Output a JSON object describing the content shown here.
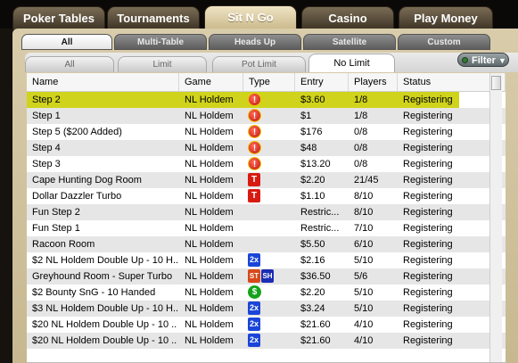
{
  "main_tabs": [
    "Poker Tables",
    "Tournaments",
    "Sit N Go",
    "Casino",
    "Play Money"
  ],
  "active_main_tab": "Sit N Go",
  "sub_tabs": [
    "All",
    "Multi-Table",
    "Heads Up",
    "Satellite",
    "Custom"
  ],
  "active_sub_tab": "All",
  "limit_tabs": [
    "All",
    "Limit",
    "Pot Limit",
    "No Limit"
  ],
  "active_limit_tab": "No Limit",
  "filter_label": "Filter",
  "columns": [
    "Name",
    "Game",
    "Type",
    "Entry",
    "Players",
    "Status"
  ],
  "rows": [
    {
      "name": "Step 2",
      "game": "NL Holdem",
      "type": "excl",
      "entry": "$3.60",
      "players": "1/8",
      "status": "Registering"
    },
    {
      "name": "Step 1",
      "game": "NL Holdem",
      "type": "excl",
      "entry": "$1",
      "players": "1/8",
      "status": "Registering"
    },
    {
      "name": "Step 5 ($200 Added)",
      "game": "NL Holdem",
      "type": "excl",
      "entry": "$176",
      "players": "0/8",
      "status": "Registering"
    },
    {
      "name": "Step 4",
      "game": "NL Holdem",
      "type": "excl",
      "entry": "$48",
      "players": "0/8",
      "status": "Registering"
    },
    {
      "name": "Step 3",
      "game": "NL Holdem",
      "type": "excl",
      "entry": "$13.20",
      "players": "0/8",
      "status": "Registering"
    },
    {
      "name": "Cape Hunting Dog Room",
      "game": "NL Holdem",
      "type": "t",
      "entry": "$2.20",
      "players": "21/45",
      "status": "Registering"
    },
    {
      "name": "Dollar Dazzler Turbo",
      "game": "NL Holdem",
      "type": "t",
      "entry": "$1.10",
      "players": "8/10",
      "status": "Registering"
    },
    {
      "name": "Fun Step 2",
      "game": "NL Holdem",
      "type": "",
      "entry": "Restric...",
      "players": "8/10",
      "status": "Registering"
    },
    {
      "name": "Fun Step 1",
      "game": "NL Holdem",
      "type": "",
      "entry": "Restric...",
      "players": "7/10",
      "status": "Registering"
    },
    {
      "name": "Racoon Room",
      "game": "NL Holdem",
      "type": "",
      "entry": "$5.50",
      "players": "6/10",
      "status": "Registering"
    },
    {
      "name": "$2 NL Holdem Double Up - 10 H...",
      "game": "NL Holdem",
      "type": "x2",
      "entry": "$2.16",
      "players": "5/10",
      "status": "Registering"
    },
    {
      "name": "Greyhound Room - Super Turbo",
      "game": "NL Holdem",
      "type": "stsh",
      "entry": "$36.50",
      "players": "5/6",
      "status": "Registering"
    },
    {
      "name": "$2 Bounty SnG - 10 Handed",
      "game": "NL Holdem",
      "type": "dollar",
      "entry": "$2.20",
      "players": "5/10",
      "status": "Registering"
    },
    {
      "name": "$3 NL Holdem Double Up - 10 H...",
      "game": "NL Holdem",
      "type": "x2",
      "entry": "$3.24",
      "players": "5/10",
      "status": "Registering"
    },
    {
      "name": "$20 NL Holdem Double Up - 10 ...",
      "game": "NL Holdem",
      "type": "x2",
      "entry": "$21.60",
      "players": "4/10",
      "status": "Registering"
    },
    {
      "name": "$20 NL Holdem Double Up - 10 ...",
      "game": "NL Holdem",
      "type": "x2",
      "entry": "$21.60",
      "players": "4/10",
      "status": "Registering"
    }
  ],
  "icon_glyphs": {
    "excl": "!",
    "t": "T",
    "x2": "2x",
    "dollar": "$",
    "st": "ST",
    "sh": "SH"
  },
  "highlight_color": "#cfd31b"
}
